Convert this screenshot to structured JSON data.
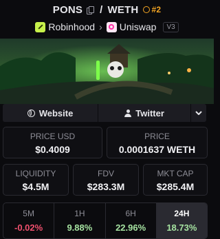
{
  "header": {
    "base": "PONS",
    "slash": "/",
    "quote": "WETH",
    "rank": "#2"
  },
  "sub": {
    "chain": "Robinhood",
    "dex": "Uniswap",
    "version": "V3"
  },
  "links": {
    "website": "Website",
    "twitter": "Twitter"
  },
  "stats": {
    "price_usd_label": "PRICE USD",
    "price_usd": "$0.4009",
    "price_label": "PRICE",
    "price": "0.0001637 WETH",
    "liquidity_label": "LIQUIDITY",
    "liquidity": "$4.5M",
    "fdv_label": "FDV",
    "fdv": "$283.3M",
    "mcap_label": "MKT CAP",
    "mcap": "$285.4M"
  },
  "changes": [
    {
      "label": "5M",
      "value": "-0.02%",
      "color": "#f0506e"
    },
    {
      "label": "1H",
      "value": "9.88%",
      "color": "#a6e3a1"
    },
    {
      "label": "6H",
      "value": "22.96%",
      "color": "#a6e3a1"
    },
    {
      "label": "24H",
      "value": "18.73%",
      "color": "#a6e3a1"
    }
  ],
  "colors": {
    "rank": "#f5a623",
    "negative": "#f0506e",
    "positive": "#a6e3a1"
  }
}
